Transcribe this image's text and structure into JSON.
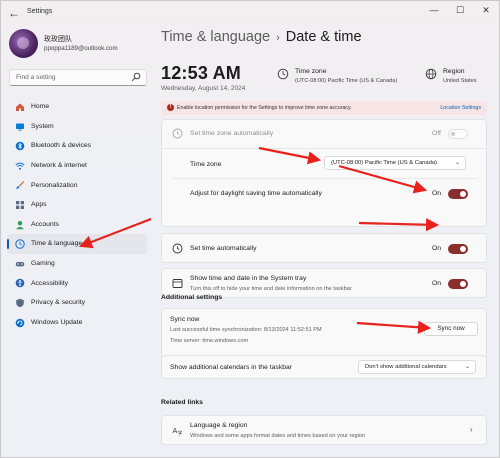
{
  "window": {
    "app_title": "Settings",
    "back_icon": "back-arrow-icon",
    "controls": [
      "minimize-icon",
      "maximize-icon",
      "close-icon"
    ]
  },
  "user": {
    "name": "玫玫团队",
    "email": "ppoppa1189@outlook.com"
  },
  "search": {
    "placeholder": "Find a setting"
  },
  "nav": {
    "items": [
      {
        "label": "Home",
        "icon": "home-icon",
        "color": "#d4553c"
      },
      {
        "label": "System",
        "icon": "system-icon",
        "color": "#0a7cd6"
      },
      {
        "label": "Bluetooth & devices",
        "icon": "bluetooth-icon",
        "color": "#0a6fd0"
      },
      {
        "label": "Network & internet",
        "icon": "wifi-icon",
        "color": "#0a6fd0"
      },
      {
        "label": "Personalization",
        "icon": "brush-icon",
        "color": "#d46c2a"
      },
      {
        "label": "Apps",
        "icon": "apps-icon",
        "color": "#5a6b85"
      },
      {
        "label": "Accounts",
        "icon": "person-icon",
        "color": "#2f9c5a"
      },
      {
        "label": "Time & language",
        "icon": "globe-clock-icon",
        "color": "#0a6fd0"
      },
      {
        "label": "Gaming",
        "icon": "gamepad-icon",
        "color": "#5a6b85"
      },
      {
        "label": "Accessibility",
        "icon": "accessibility-icon",
        "color": "#1f5fb0"
      },
      {
        "label": "Privacy & security",
        "icon": "shield-icon",
        "color": "#5a6b85"
      },
      {
        "label": "Windows Update",
        "icon": "update-icon",
        "color": "#0a6fd0"
      }
    ],
    "selected_index": 7
  },
  "breadcrumb": {
    "parent": "Time & language",
    "separator": "›",
    "current": "Date & time"
  },
  "clock": {
    "time": "12:53 AM",
    "date": "Wednesday, August 14, 2024"
  },
  "time_zone_info": {
    "label": "Time zone",
    "value": "(UTC-08:00) Pacific Time (US & Canada)"
  },
  "region_info": {
    "label": "Region",
    "value": "United States"
  },
  "notice": {
    "text": "Enable location permission for the Settings to improve time zone accuracy.",
    "link": "Location Settings"
  },
  "settings": {
    "set_tz_auto": {
      "label": "Set time zone automatically",
      "state": "Off",
      "on": false
    },
    "time_zone": {
      "label": "Time zone",
      "value": "(UTC-08:00) Pacific Time (US & Canada)"
    },
    "dst": {
      "label": "Adjust for daylight saving time automatically",
      "state": "On",
      "on": true
    },
    "set_time_auto": {
      "label": "Set time automatically",
      "state": "On",
      "on": true
    },
    "show_tray": {
      "label": "Show time and date in the System tray",
      "sub": "Turn this off to hide your time and date information on the taskbar",
      "state": "On",
      "on": true
    }
  },
  "additional": {
    "title": "Additional settings",
    "sync": {
      "title": "Sync now",
      "last_sync": "Last successful time synchronization: 8/13/2024 11:52:51 PM",
      "server": "Time server: time.windows.com",
      "button": "Sync now"
    },
    "calendars": {
      "label": "Show additional calendars in the taskbar",
      "value": "Don't show additional calendars"
    }
  },
  "related": {
    "title": "Related links",
    "language_region": {
      "title": "Language & region",
      "sub": "Windows and some apps format dates and times based on your region"
    }
  },
  "colors": {
    "accent": "#0a5fb4",
    "toggle_on": "#8a2d2d",
    "arrow": "#e8211c"
  }
}
